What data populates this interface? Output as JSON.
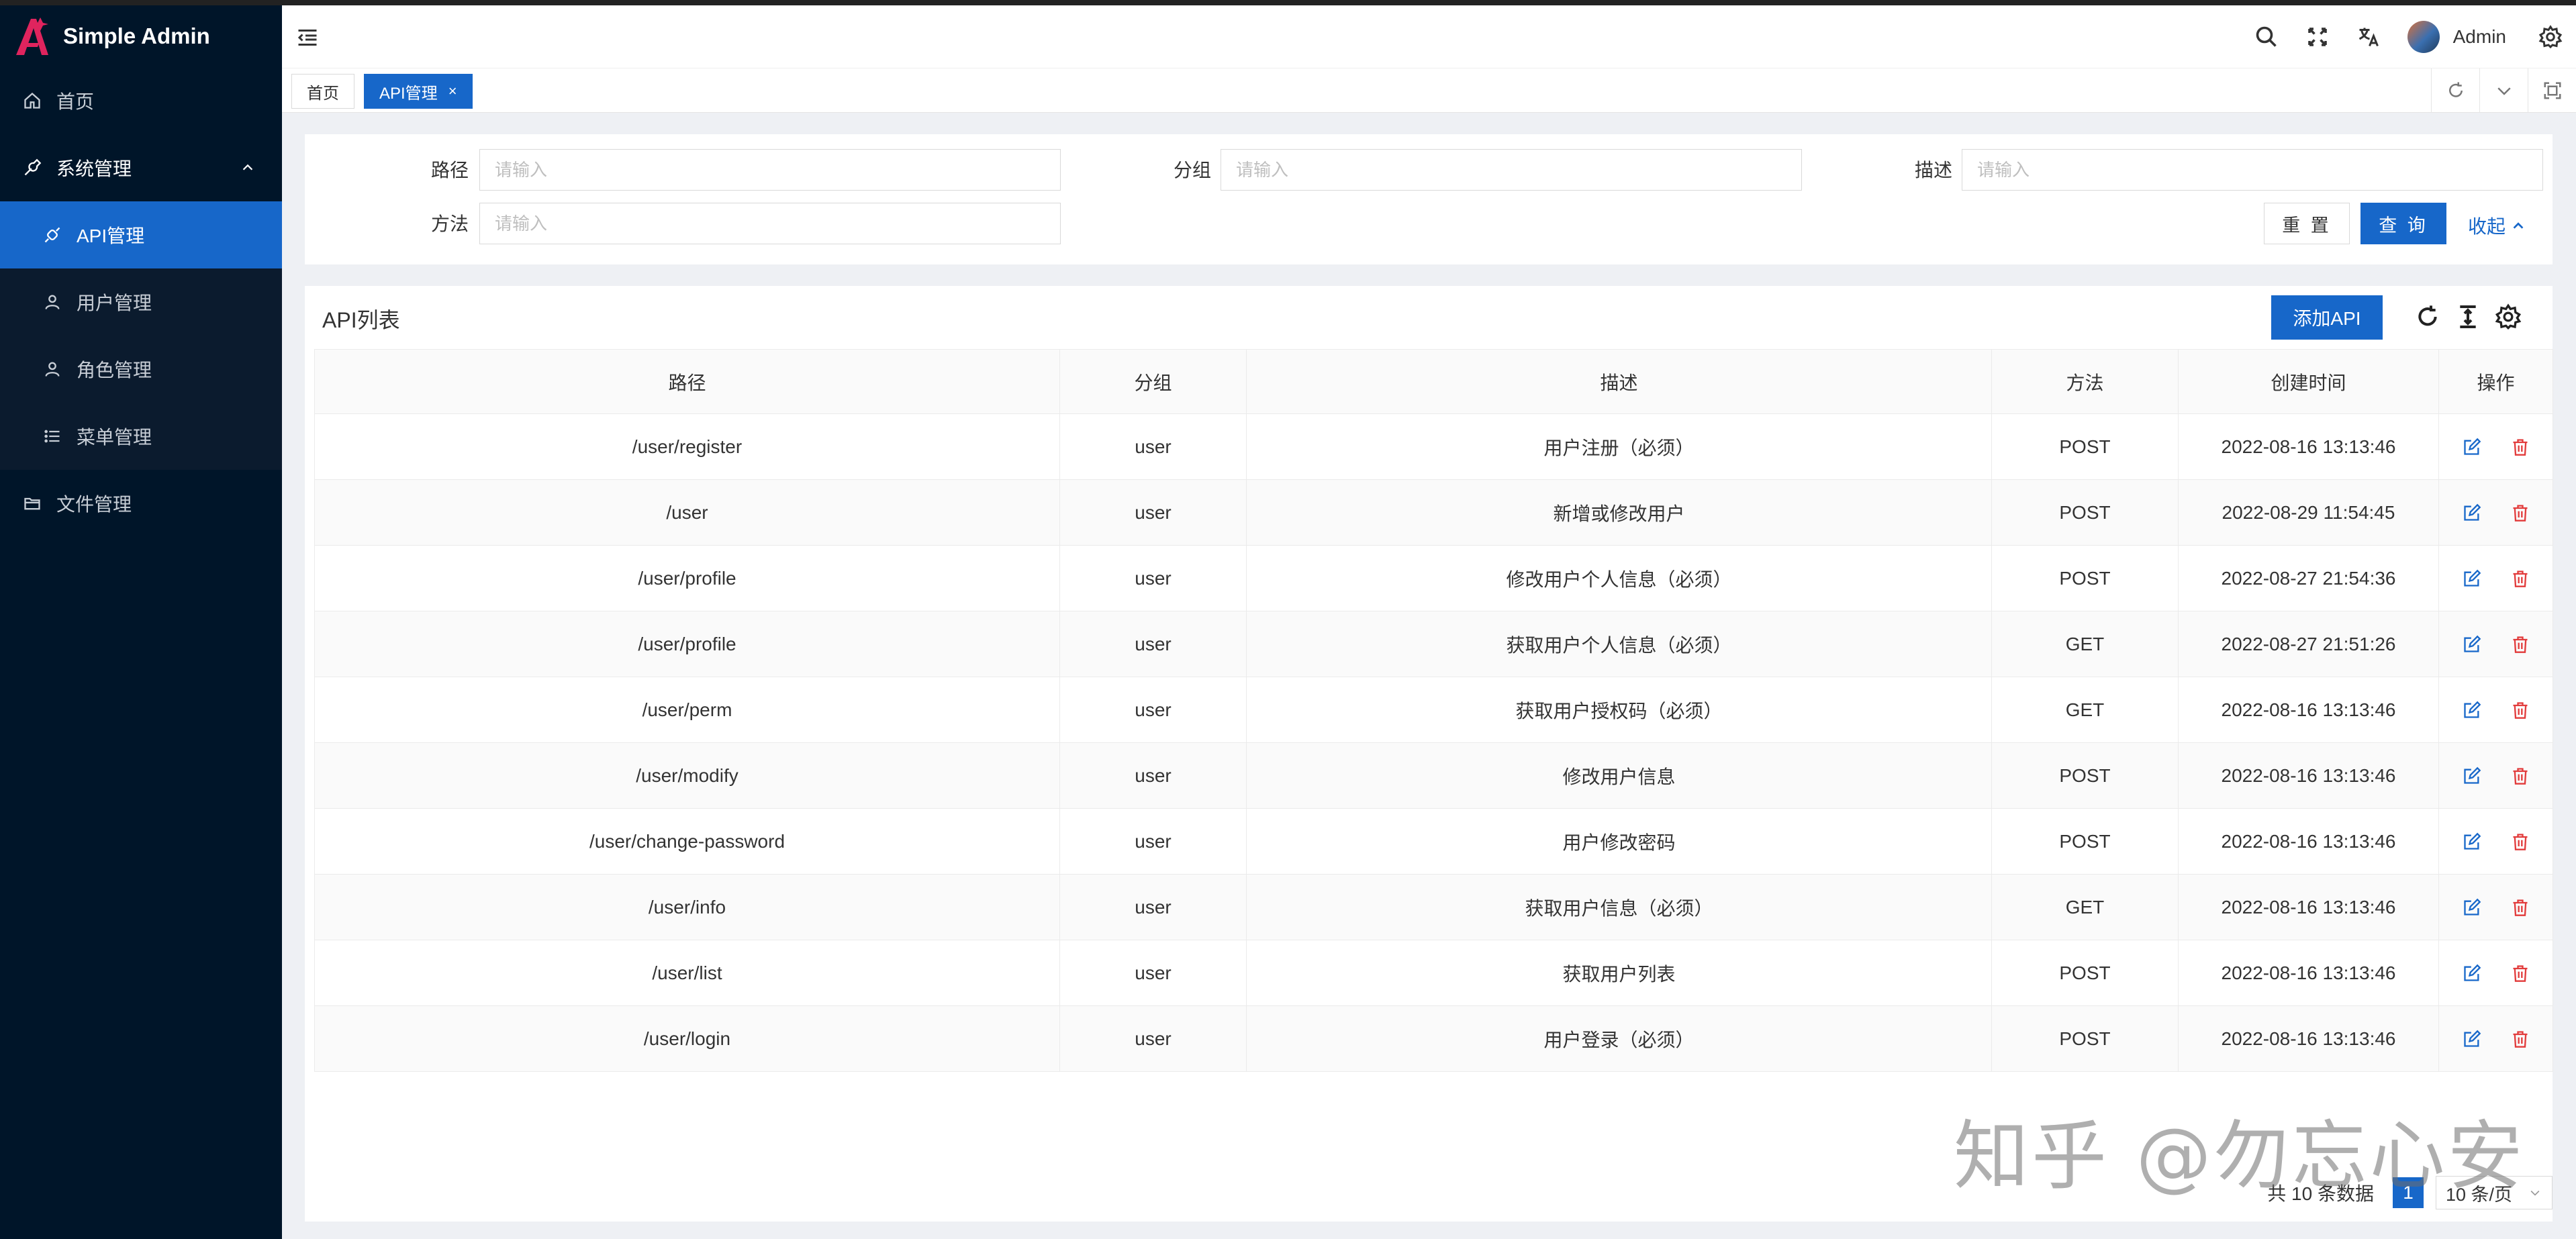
{
  "app": {
    "title": "Simple Admin"
  },
  "sidebar": {
    "items": [
      {
        "label": "首页"
      },
      {
        "label": "系统管理"
      },
      {
        "label": "文件管理"
      }
    ],
    "submenu": [
      {
        "label": "API管理"
      },
      {
        "label": "用户管理"
      },
      {
        "label": "角色管理"
      },
      {
        "label": "菜单管理"
      }
    ]
  },
  "header": {
    "user": "Admin"
  },
  "tabs": [
    {
      "label": "首页"
    },
    {
      "label": "API管理",
      "close": "×"
    }
  ],
  "search": {
    "fields": [
      {
        "label": "路径",
        "placeholder": "请输入"
      },
      {
        "label": "分组",
        "placeholder": "请输入"
      },
      {
        "label": "描述",
        "placeholder": "请输入"
      },
      {
        "label": "方法",
        "placeholder": "请输入"
      }
    ],
    "reset_label": "重 置",
    "query_label": "查 询",
    "collapse_label": "收起"
  },
  "list": {
    "title": "API列表",
    "add_label": "添加API",
    "columns": [
      "路径",
      "分组",
      "描述",
      "方法",
      "创建时间",
      "操作"
    ],
    "rows": [
      {
        "path": "/user/register",
        "group": "user",
        "desc": "用户注册（必须）",
        "method": "POST",
        "created": "2022-08-16 13:13:46"
      },
      {
        "path": "/user",
        "group": "user",
        "desc": "新增或修改用户",
        "method": "POST",
        "created": "2022-08-29 11:54:45"
      },
      {
        "path": "/user/profile",
        "group": "user",
        "desc": "修改用户个人信息（必须）",
        "method": "POST",
        "created": "2022-08-27 21:54:36"
      },
      {
        "path": "/user/profile",
        "group": "user",
        "desc": "获取用户个人信息（必须）",
        "method": "GET",
        "created": "2022-08-27 21:51:26"
      },
      {
        "path": "/user/perm",
        "group": "user",
        "desc": "获取用户授权码（必须）",
        "method": "GET",
        "created": "2022-08-16 13:13:46"
      },
      {
        "path": "/user/modify",
        "group": "user",
        "desc": "修改用户信息",
        "method": "POST",
        "created": "2022-08-16 13:13:46"
      },
      {
        "path": "/user/change-password",
        "group": "user",
        "desc": "用户修改密码",
        "method": "POST",
        "created": "2022-08-16 13:13:46"
      },
      {
        "path": "/user/info",
        "group": "user",
        "desc": "获取用户信息（必须）",
        "method": "GET",
        "created": "2022-08-16 13:13:46"
      },
      {
        "path": "/user/list",
        "group": "user",
        "desc": "获取用户列表",
        "method": "POST",
        "created": "2022-08-16 13:13:46"
      },
      {
        "path": "/user/login",
        "group": "user",
        "desc": "用户登录（必须）",
        "method": "POST",
        "created": "2022-08-16 13:13:46"
      }
    ]
  },
  "pagination": {
    "total": "共 10 条数据",
    "page": "1",
    "page_size": "10 条/页"
  },
  "watermark": "知乎 @勿忘心安",
  "colors": {
    "primary": "#1767c9",
    "sidebar_bg": "#001529",
    "danger": "#e23b3b",
    "logo": "#e0245e"
  }
}
